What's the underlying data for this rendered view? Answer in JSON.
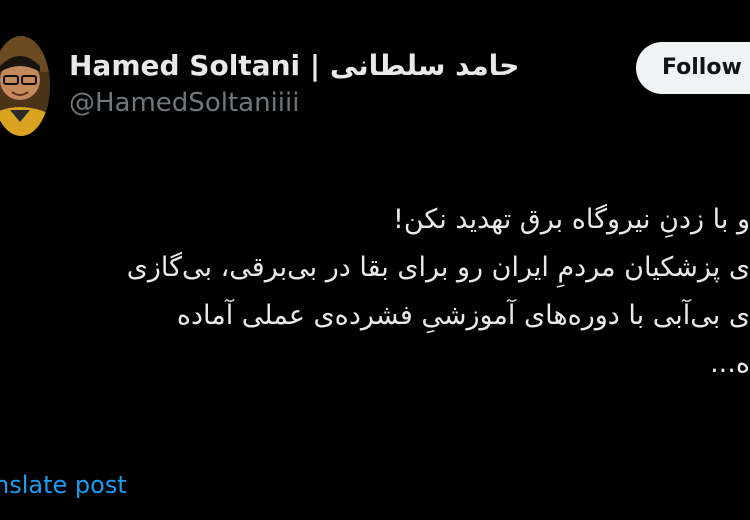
{
  "author": {
    "display_name": "Hamed Soltani | حامد سلطانی",
    "handle": "@HamedSoltaniiii",
    "avatar_icon": "profile-photo"
  },
  "follow_button": {
    "label": "Follow"
  },
  "post": {
    "lines": [
      "و با زدنِ نیروگاه برق تهدید نکن!",
      "ی پزشکیان مردمِ ایران رو برای بقا در بی‌برقی، بی‌گازی",
      "ی بی‌آبی با دوره‌های آموزشیِ فشرده‌ی عملی آماده",
      "ه..."
    ]
  },
  "translate": {
    "label": "nslate post"
  },
  "colors": {
    "background": "#000000",
    "text": "#e7e9ea",
    "secondary": "#71767b",
    "link": "#1d9bf0",
    "button_bg": "#eff3f4"
  }
}
